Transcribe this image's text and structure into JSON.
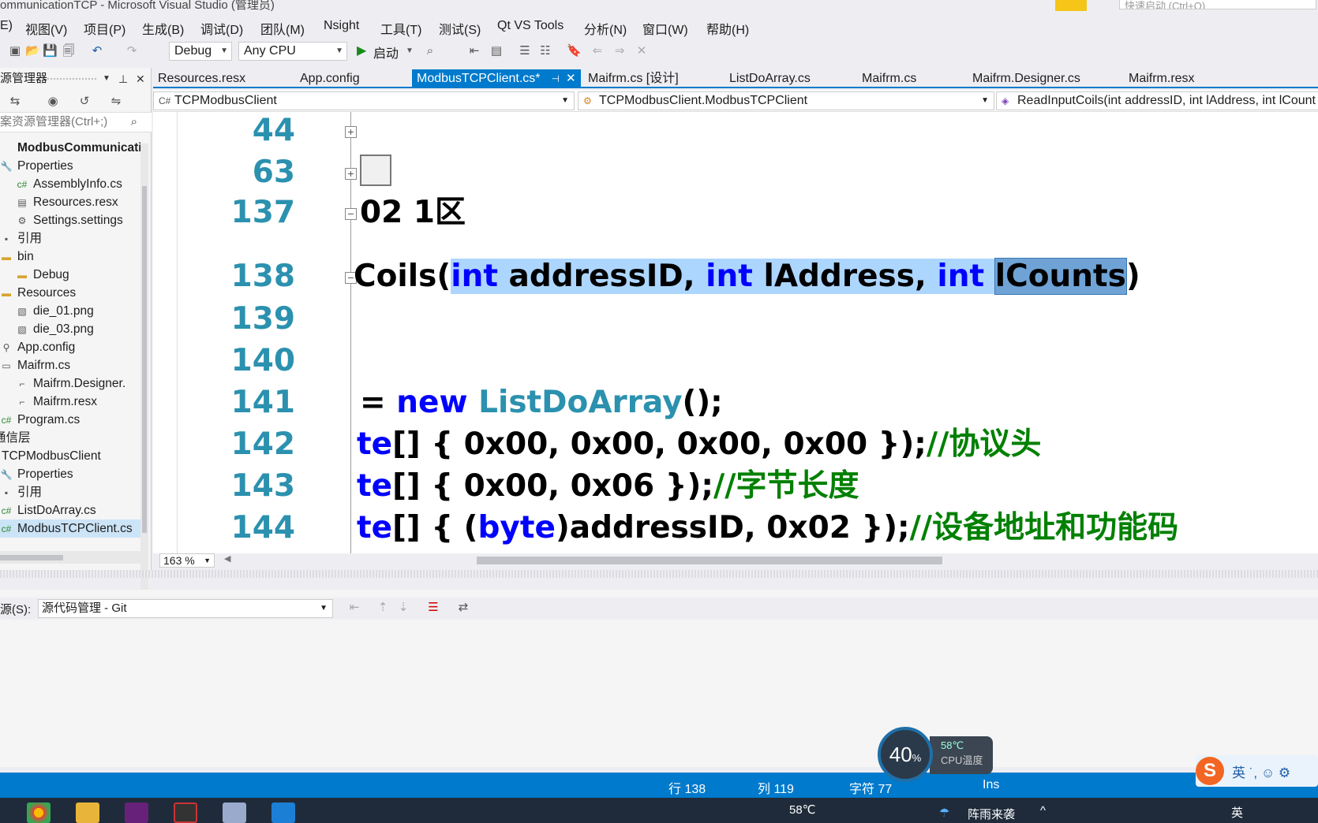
{
  "window": {
    "title": "ommunicationTCP - Microsoft Visual Studio (管理员)",
    "quick_launch_placeholder": "快速启动 (Ctrl+Q)"
  },
  "menu": [
    "E)",
    "视图(V)",
    "项目(P)",
    "生成(B)",
    "调试(D)",
    "团队(M)",
    "Nsight",
    "工具(T)",
    "测试(S)",
    "Qt VS Tools",
    "分析(N)",
    "窗口(W)",
    "帮助(H)"
  ],
  "toolbar": {
    "config": "Debug",
    "platform": "Any CPU",
    "start": "启动"
  },
  "solution_explorer": {
    "title": "源管理器",
    "search_placeholder": "案资源管理器(Ctrl+;)",
    "items": [
      {
        "label": "ModbusCommunicatic",
        "icon": "project-icon"
      },
      {
        "label": "Properties",
        "icon": "wrench-icon"
      },
      {
        "label": "AssemblyInfo.cs",
        "icon": "csharp-file-icon"
      },
      {
        "label": "Resources.resx",
        "icon": "resx-file-icon"
      },
      {
        "label": "Settings.settings",
        "icon": "settings-gear-icon"
      },
      {
        "label": "引用",
        "icon": "references-icon"
      },
      {
        "label": "bin",
        "icon": "folder-icon"
      },
      {
        "label": "Debug",
        "icon": "folder-icon"
      },
      {
        "label": "Resources",
        "icon": "folder-icon"
      },
      {
        "label": "die_01.png",
        "icon": "image-file-icon"
      },
      {
        "label": "die_03.png",
        "icon": "image-file-icon"
      },
      {
        "label": "App.config",
        "icon": "config-file-icon"
      },
      {
        "label": "Maifrm.cs",
        "icon": "form-file-icon"
      },
      {
        "label": "Maifrm.Designer.",
        "icon": "designer-file-icon"
      },
      {
        "label": "Maifrm.resx",
        "icon": "resx-file-icon"
      },
      {
        "label": "Program.cs",
        "icon": "csharp-file-icon"
      },
      {
        "label": "通信层",
        "icon": "none"
      },
      {
        "label": "TCPModbusClient",
        "icon": "project-icon"
      },
      {
        "label": "Properties",
        "icon": "wrench-icon"
      },
      {
        "label": "引用",
        "icon": "references-icon"
      },
      {
        "label": "ListDoArray.cs",
        "icon": "csharp-file-icon"
      },
      {
        "label": "ModbusTCPClient.cs",
        "icon": "csharp-file-icon"
      }
    ]
  },
  "tabs": [
    {
      "label": "Resources.resx"
    },
    {
      "label": "App.config"
    },
    {
      "label": "ModbusTCPClient.cs*",
      "active": true
    },
    {
      "label": "Maifrm.cs [设计]"
    },
    {
      "label": "ListDoArray.cs"
    },
    {
      "label": "Maifrm.cs"
    },
    {
      "label": "Maifrm.Designer.cs"
    },
    {
      "label": "Maifrm.resx"
    }
  ],
  "navbar": {
    "project": "TCPModbusClient",
    "class": "TCPModbusClient.ModbusTCPClient",
    "member": "ReadInputCoils(int addressID, int lAddress, int lCount"
  },
  "editor": {
    "zoom": "163 %",
    "lines": [
      {
        "num": "44",
        "text": ""
      },
      {
        "num": "63",
        "text": ""
      },
      {
        "num": "137",
        "text": "02 1区"
      },
      {
        "num": "138",
        "p1": "Coils(",
        "k1": "int",
        "p2": " addressID, ",
        "k2": "int",
        "p3": " lAddress, ",
        "k3": "int",
        "p4": " ",
        "p5": "lCounts",
        "p6": ")"
      },
      {
        "num": "139",
        "text": ""
      },
      {
        "num": "140",
        "text": ""
      },
      {
        "num": "141",
        "p1": " = ",
        "k1": "new",
        "t1": " ListDoArray",
        "p2": "();"
      },
      {
        "num": "142",
        "t1": "te",
        "p1": "[] { 0x00, 0x00, 0x00, 0x00 });",
        "c1": "//协议头"
      },
      {
        "num": "143",
        "t1": "te",
        "p1": "[] { 0x00, 0x06 });",
        "c1": "//字节长度"
      },
      {
        "num": "144",
        "t1": "te",
        "p1": "[] { (",
        "k1": "byte",
        "p2": ")addressID, 0x02 });",
        "c1": "//设备地址和功能码"
      }
    ]
  },
  "output": {
    "source_label": "源(S):",
    "source_value": "源代码管理 - Git"
  },
  "statusbar": {
    "line": "行 138",
    "col": "列 119",
    "char": "字符 77",
    "mode": "Ins"
  },
  "cpu_widget": {
    "usage": "40",
    "unit": "%",
    "temp": "58℃",
    "label": "CPU温度"
  },
  "ime": {
    "text": "英 ˙, ☺ ⚙"
  },
  "taskbar": {
    "temp": "58℃",
    "weather": "阵雨来袭",
    "ime": "英"
  }
}
